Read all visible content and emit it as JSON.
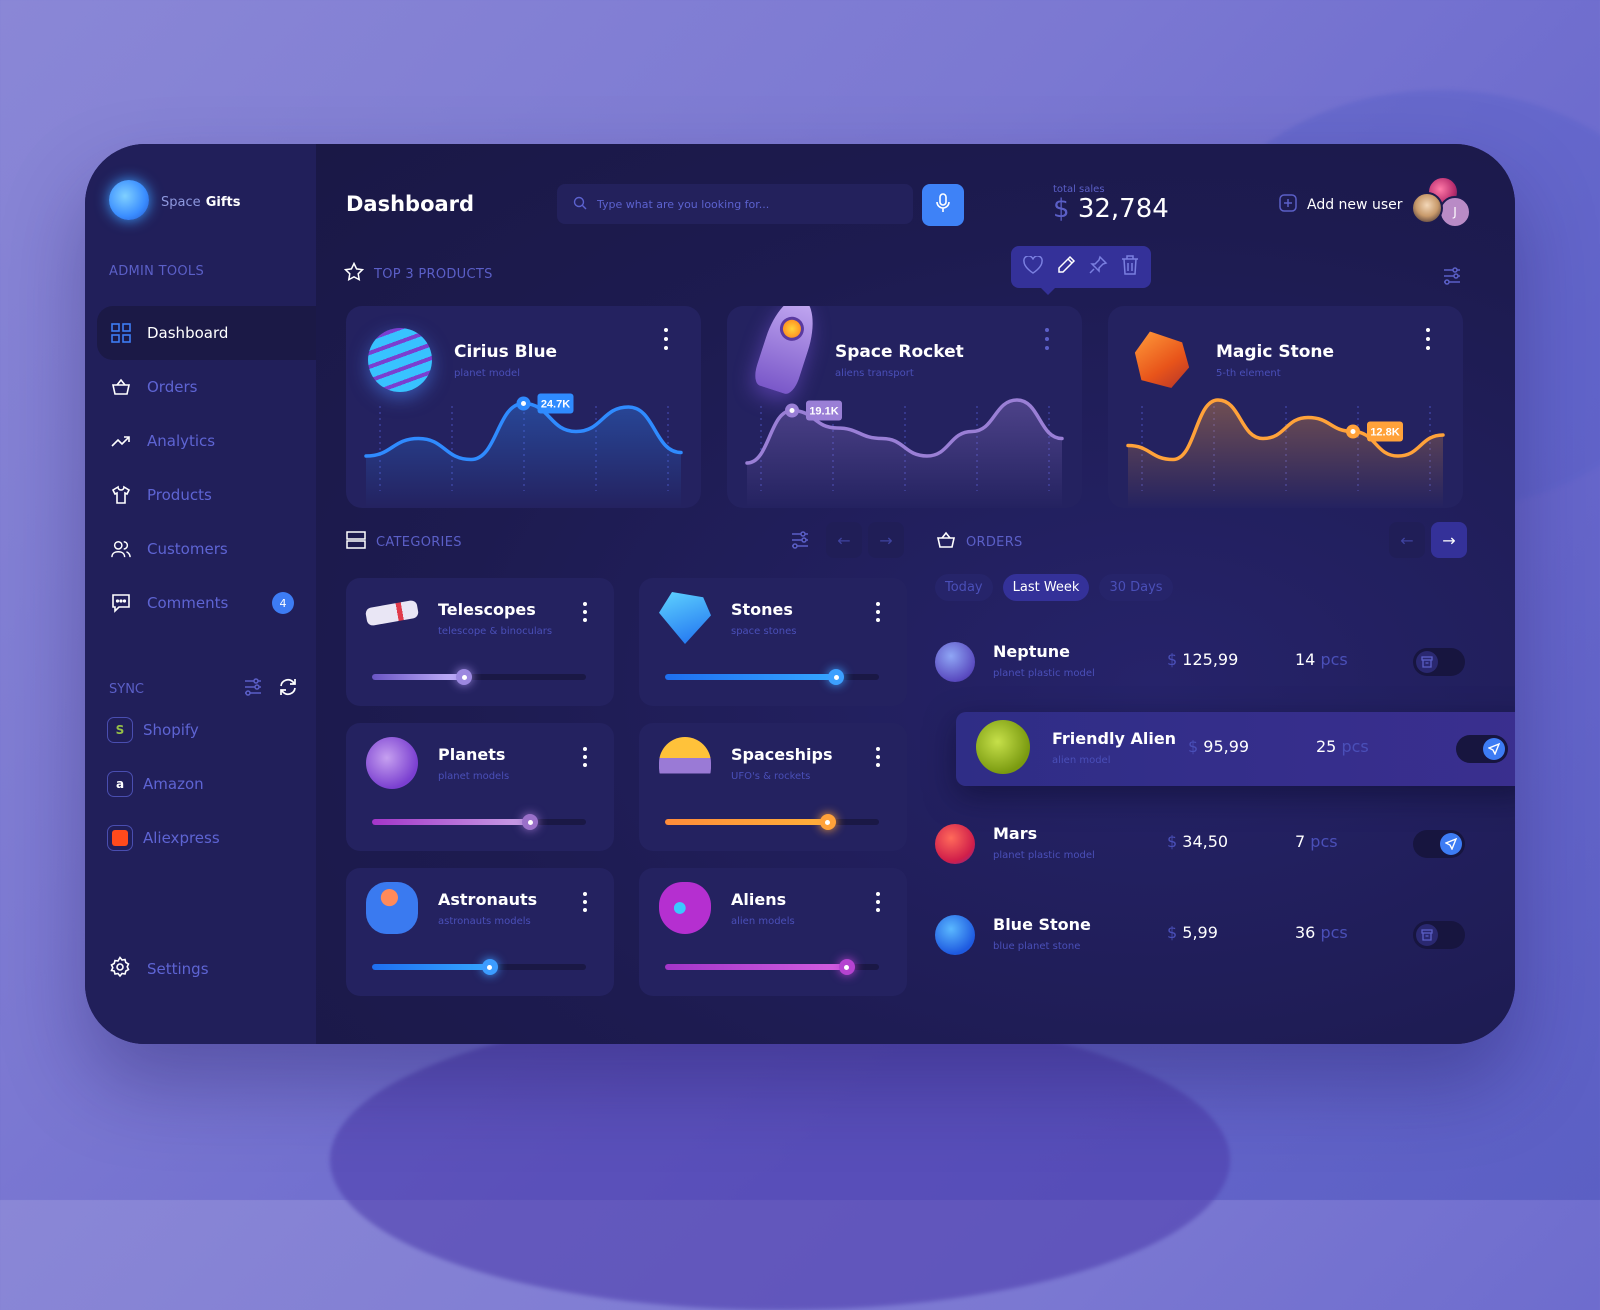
{
  "brand": {
    "name_light": "Space",
    "name_bold": "Gifts"
  },
  "sidebar": {
    "section_label": "ADMIN TOOLS",
    "items": [
      {
        "label": "Dashboard",
        "icon": "grid-icon",
        "active": true
      },
      {
        "label": "Orders",
        "icon": "basket-icon"
      },
      {
        "label": "Analytics",
        "icon": "trending-up-icon"
      },
      {
        "label": "Products",
        "icon": "tshirt-icon"
      },
      {
        "label": "Customers",
        "icon": "users-icon"
      },
      {
        "label": "Comments",
        "icon": "chat-icon",
        "badge": "4"
      }
    ],
    "sync_label": "SYNC",
    "sync_items": [
      {
        "label": "Shopify",
        "icon": "shopify-icon",
        "color": "#95bf47",
        "glyph": "S"
      },
      {
        "label": "Amazon",
        "icon": "amazon-icon",
        "color": "#ffffff",
        "glyph": "a"
      },
      {
        "label": "Aliexpress",
        "icon": "aliexpress-icon",
        "color": "#ff4a1c",
        "glyph": "◡"
      }
    ],
    "settings_label": "Settings"
  },
  "header": {
    "title": "Dashboard",
    "search_placeholder": "Type what are you looking for...",
    "total_sales_label": "total sales",
    "total_sales_currency": "$",
    "total_sales_value": "32,784",
    "add_user_label": "Add new user",
    "avatar_initial": "J"
  },
  "top_products": {
    "label": "TOP 3 PRODUCTS",
    "toolbar": [
      "heart-icon",
      "pencil-icon",
      "pin-icon",
      "trash-icon"
    ],
    "items": [
      {
        "name": "Cirius Blue",
        "subtitle": "planet model",
        "tooltip": "24.7K",
        "color": "#2f8bff",
        "series": [
          0.2,
          0.45,
          0.15,
          0.95,
          0.55,
          0.9,
          0.25
        ],
        "highlight": 3
      },
      {
        "name": "Space Rocket",
        "subtitle": "aliens transport",
        "tooltip": "19.1K",
        "color": "#9a7fd6",
        "series": [
          0.1,
          0.85,
          0.6,
          0.45,
          0.2,
          0.55,
          1.0,
          0.45
        ],
        "highlight": 1
      },
      {
        "name": "Magic Stone",
        "subtitle": "5-th element",
        "tooltip": "12.8K",
        "color": "#ffa23a",
        "series": [
          0.35,
          0.15,
          1.0,
          0.45,
          0.75,
          0.55,
          0.2,
          0.5
        ],
        "highlight": 5
      }
    ]
  },
  "categories": {
    "label": "CATEGORIES",
    "items": [
      {
        "name": "Telescopes",
        "subtitle": "telescope & binoculars",
        "value": 0.43,
        "from": "#6a55c4",
        "to": "#c9b9ff",
        "knob": "#9c88e0"
      },
      {
        "name": "Stones",
        "subtitle": "space stones",
        "value": 0.8,
        "from": "#1e6ff0",
        "to": "#35a7ff",
        "knob": "#3ca0ff"
      },
      {
        "name": "Planets",
        "subtitle": "planet models",
        "value": 0.74,
        "from": "#a335c9",
        "to": "#c9a3e6",
        "knob": "#9a70c9"
      },
      {
        "name": "Spaceships",
        "subtitle": "UFO's & rockets",
        "value": 0.76,
        "from": "#ff8c3a",
        "to": "#ffb03a",
        "knob": "#ffa23a"
      },
      {
        "name": "Astronauts",
        "subtitle": "astronauts models",
        "value": 0.55,
        "from": "#1e6ff0",
        "to": "#35a7ff",
        "knob": "#3c9cff"
      },
      {
        "name": "Aliens",
        "subtitle": "alien models",
        "value": 0.85,
        "from": "#a335c9",
        "to": "#d35fe0",
        "knob": "#b543d0"
      }
    ]
  },
  "orders": {
    "label": "ORDERS",
    "filters": [
      {
        "label": "Today",
        "active": false
      },
      {
        "label": "Last Week",
        "active": true
      },
      {
        "label": "30 Days",
        "active": false
      }
    ],
    "rows": [
      {
        "name": "Neptune",
        "subtitle": "planet plastic model",
        "currency": "$",
        "price": "125,99",
        "qty": "14",
        "unit": "pcs",
        "status": "archive",
        "on": false
      },
      {
        "name": "Friendly Alien",
        "subtitle": "alien model",
        "currency": "$",
        "price": "95,99",
        "qty": "25",
        "unit": "pcs",
        "status": "send",
        "on": true
      },
      {
        "name": "Mars",
        "subtitle": "planet plastic model",
        "currency": "$",
        "price": "34,50",
        "qty": "7",
        "unit": "pcs",
        "status": "send",
        "on": true
      },
      {
        "name": "Blue Stone",
        "subtitle": "blue planet stone",
        "currency": "$",
        "price": "5,99",
        "qty": "36",
        "unit": "pcs",
        "status": "archive",
        "on": false
      }
    ]
  }
}
